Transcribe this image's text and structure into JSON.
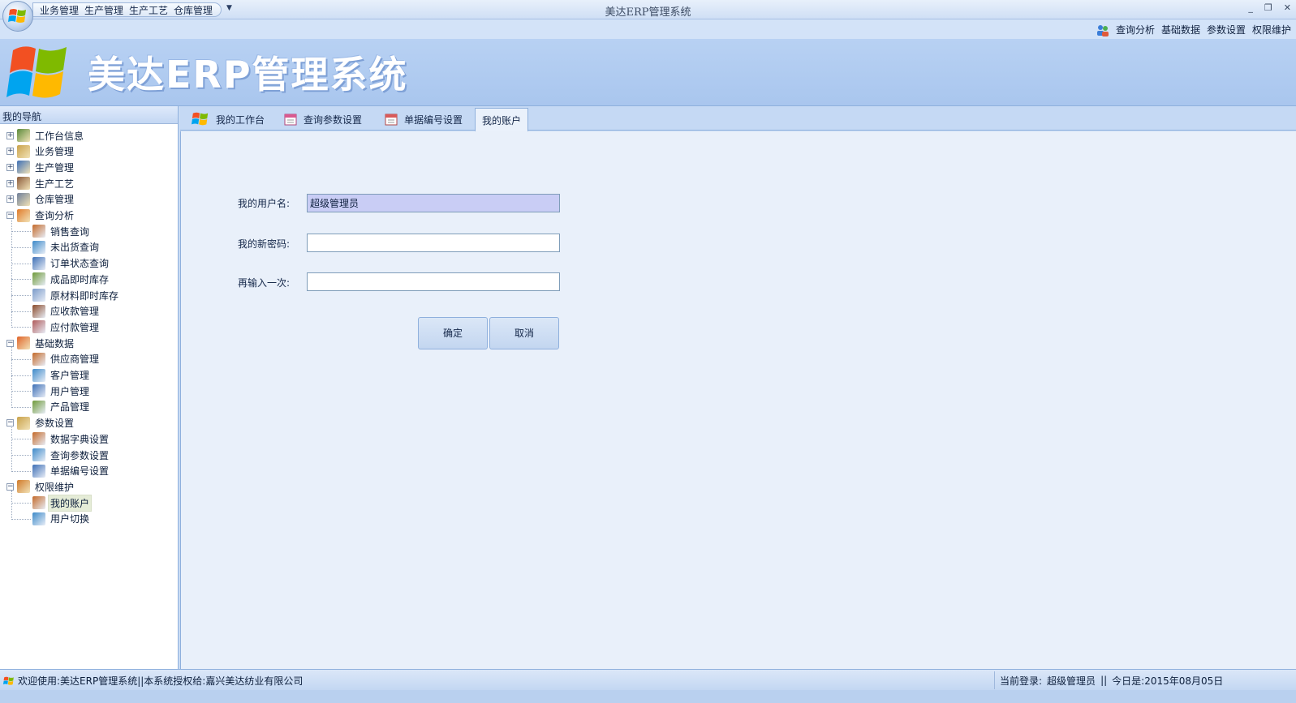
{
  "titlebar": {
    "title": "美达ERP管理系统",
    "qat_items": [
      "业务管理",
      "生产管理",
      "生产工艺",
      "仓库管理"
    ],
    "minimize": "_",
    "restore": "❐",
    "close": "✕"
  },
  "quick_menu": [
    "查询分析",
    "基础数据",
    "参数设置",
    "权限维护"
  ],
  "banner": {
    "title": "美达ERP管理系统"
  },
  "nav": {
    "header": "我的导航",
    "groups": [
      {
        "label": "工作台信息",
        "expanded": false,
        "icon": "workbench-icon"
      },
      {
        "label": "业务管理",
        "expanded": false,
        "icon": "business-icon"
      },
      {
        "label": "生产管理",
        "expanded": false,
        "icon": "production-icon"
      },
      {
        "label": "生产工艺",
        "expanded": false,
        "icon": "process-icon"
      },
      {
        "label": "仓库管理",
        "expanded": false,
        "icon": "warehouse-icon"
      },
      {
        "label": "查询分析",
        "expanded": true,
        "icon": "query-icon",
        "children": [
          "销售查询",
          "未出货查询",
          "订单状态查询",
          "成品即时库存",
          "原材料即时库存",
          "应收款管理",
          "应付款管理"
        ]
      },
      {
        "label": "基础数据",
        "expanded": true,
        "icon": "base-data-icon",
        "children": [
          "供应商管理",
          "客户管理",
          "用户管理",
          "产品管理"
        ]
      },
      {
        "label": "参数设置",
        "expanded": true,
        "icon": "settings-icon",
        "children": [
          "数据字典设置",
          "查询参数设置",
          "单据编号设置"
        ]
      },
      {
        "label": "权限维护",
        "expanded": true,
        "icon": "permission-icon",
        "children": [
          "我的账户",
          "用户切换"
        ]
      }
    ],
    "selected": "我的账户",
    "grip": "•••••••"
  },
  "tabs": [
    "我的工作台",
    "查询参数设置",
    "单据编号设置",
    "我的账户"
  ],
  "active_tab": "我的账户",
  "form": {
    "username_label": "我的用户名:",
    "username_value": "超级管理员",
    "new_password_label": "我的新密码:",
    "new_password_value": "",
    "repeat_label": "再输入一次:",
    "repeat_value": "",
    "confirm_label": "确定",
    "cancel_label": "取消"
  },
  "status": {
    "welcome": "欢迎使用:美达ERP管理系统||本系统授权给:嘉兴美达纺业有限公司",
    "login_label": "当前登录:",
    "login_user": "超级管理员",
    "separator": "||",
    "today": "今日是:2015年08月05日"
  },
  "colors": {
    "banner_bg": "#b8d1f3",
    "content_bg": "#e9f0fa",
    "readonly_input_bg": "#c9cdf5",
    "border": "#8fb0dd"
  }
}
